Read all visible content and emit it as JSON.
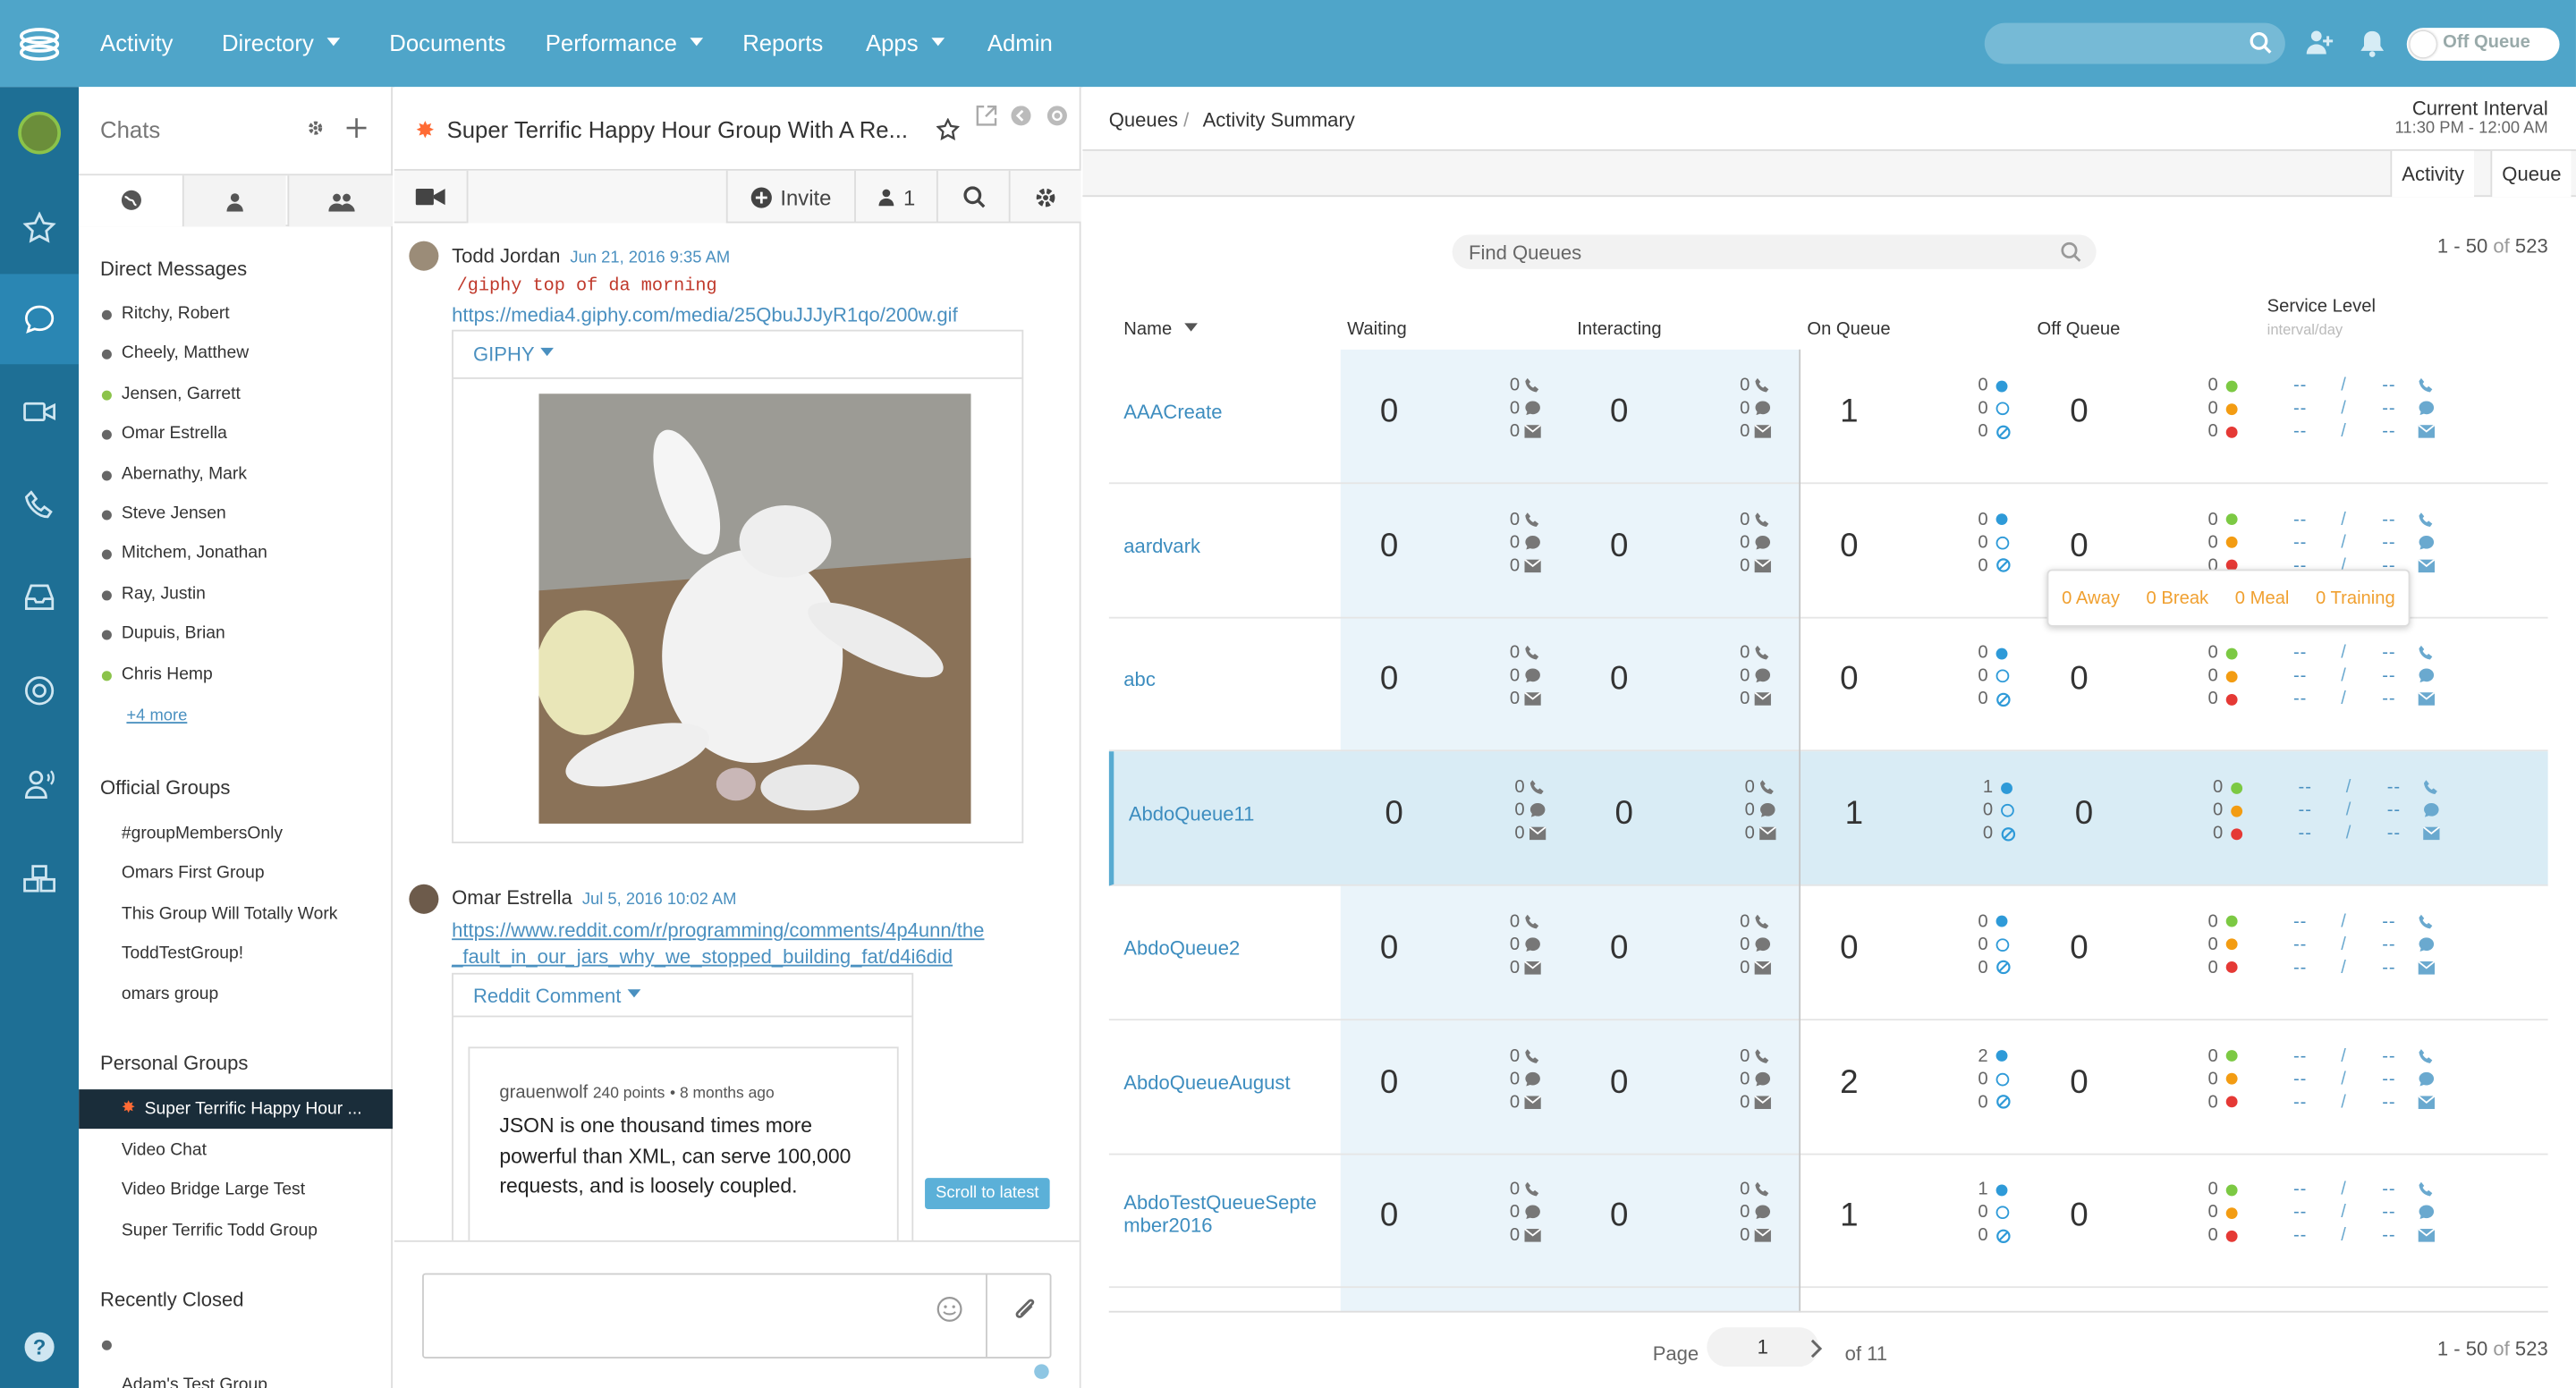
{
  "topnav": {
    "items": [
      "Activity",
      "Directory",
      "Documents",
      "Performance",
      "Reports",
      "Apps",
      "Admin"
    ],
    "status_toggle": "Off Queue"
  },
  "chats": {
    "title": "Chats",
    "direct_messages_heading": "Direct Messages",
    "direct_messages": [
      {
        "name": "Ritchy, Robert",
        "status": "offline"
      },
      {
        "name": "Cheely, Matthew",
        "status": "offline"
      },
      {
        "name": "Jensen, Garrett",
        "status": "online"
      },
      {
        "name": "Omar Estrella",
        "status": "offline"
      },
      {
        "name": "Abernathy, Mark",
        "status": "offline"
      },
      {
        "name": "Steve Jensen",
        "status": "offline"
      },
      {
        "name": "Mitchem, Jonathan",
        "status": "offline"
      },
      {
        "name": "Ray, Justin",
        "status": "offline"
      },
      {
        "name": "Dupuis, Brian",
        "status": "offline"
      },
      {
        "name": "Chris Hemp",
        "status": "online"
      }
    ],
    "more_link": "+4 more",
    "official_groups_heading": "Official Groups",
    "official_groups": [
      "#groupMembersOnly",
      "Omars First Group",
      "This Group Will Totally Work",
      "ToddTestGroup!",
      "omars group"
    ],
    "personal_groups_heading": "Personal Groups",
    "personal_groups": [
      "Super Terrific Happy Hour ...",
      "Video Chat",
      "Video Bridge Large Test",
      "Super Terrific Todd Group"
    ],
    "recently_closed_heading": "Recently Closed",
    "recently_closed": [
      "Adam's Test Group"
    ]
  },
  "conversation": {
    "title": "Super Terrific Happy Hour Group With A Re...",
    "invite_label": "Invite",
    "participants_count": "1",
    "messages": [
      {
        "author": "Todd Jordan",
        "time": "Jun 21, 2016 9:35 AM",
        "command": "/giphy top of da morning",
        "link": "https://media4.giphy.com/media/25QbuJJJyR1qo/200w.gif",
        "card_title": "GIPHY"
      },
      {
        "author": "Omar Estrella",
        "time": "Jul 5, 2016 10:02 AM",
        "link_line1": "https://www.reddit.com/r/programming/comments/4p4unn/the",
        "link_line2": "_fault_in_our_jars_why_we_stopped_building_fat/d4i6did",
        "card_title": "Reddit Comment",
        "comment_user": "grauenwolf",
        "comment_points": "240 points",
        "comment_age": "• 8 months ago",
        "comment_text": "JSON is one thousand times more powerful than XML, can serve 100,000 requests, and is loosely coupled."
      }
    ],
    "scroll_to_latest": "Scroll to latest"
  },
  "queues": {
    "breadcrumb_root": "Queues",
    "breadcrumb_sep": "/",
    "breadcrumb_page": "Activity Summary",
    "interval_title": "Current Interval",
    "interval_range": "11:30 PM - 12:00 AM",
    "view_tabs": [
      "Activity",
      "Queue"
    ],
    "search_placeholder": "Find Queues",
    "count_range": "1 - 50",
    "count_of": "of",
    "count_total": "523",
    "columns": {
      "name": "Name",
      "waiting": "Waiting",
      "interacting": "Interacting",
      "on_queue": "On Queue",
      "off_queue": "Off Queue",
      "service_level": "Service Level",
      "service_level_sub": "interval/day"
    },
    "rows": [
      {
        "name": "AAACreate",
        "waiting": "0",
        "w_call": "0",
        "w_chat": "0",
        "w_email": "0",
        "interacting": "0",
        "i_call": "0",
        "i_chat": "0",
        "i_email": "0",
        "on_queue": "1",
        "oq_available": "0",
        "oq_idle": "0",
        "oq_not_responding": "0",
        "off_queue": "0",
        "off_green": "0",
        "off_orange": "0",
        "off_red": "0"
      },
      {
        "name": "aardvark",
        "waiting": "0",
        "w_call": "0",
        "w_chat": "0",
        "w_email": "0",
        "interacting": "0",
        "i_call": "0",
        "i_chat": "0",
        "i_email": "0",
        "on_queue": "0",
        "oq_available": "0",
        "oq_idle": "0",
        "oq_not_responding": "0",
        "off_queue": "0",
        "off_green": "0",
        "off_orange": "0",
        "off_red": "0"
      },
      {
        "name": "abc",
        "waiting": "0",
        "w_call": "0",
        "w_chat": "0",
        "w_email": "0",
        "interacting": "0",
        "i_call": "0",
        "i_chat": "0",
        "i_email": "0",
        "on_queue": "0",
        "oq_available": "0",
        "oq_idle": "0",
        "oq_not_responding": "0",
        "off_queue": "0",
        "off_green": "0",
        "off_orange": "0",
        "off_red": "0"
      },
      {
        "name": "AbdoQueue11",
        "waiting": "0",
        "w_call": "0",
        "w_chat": "0",
        "w_email": "0",
        "interacting": "0",
        "i_call": "0",
        "i_chat": "0",
        "i_email": "0",
        "on_queue": "1",
        "oq_available": "1",
        "oq_idle": "0",
        "oq_not_responding": "0",
        "off_queue": "0",
        "off_green": "0",
        "off_orange": "0",
        "off_red": "0"
      },
      {
        "name": "AbdoQueue2",
        "waiting": "0",
        "w_call": "0",
        "w_chat": "0",
        "w_email": "0",
        "interacting": "0",
        "i_call": "0",
        "i_chat": "0",
        "i_email": "0",
        "on_queue": "0",
        "oq_available": "0",
        "oq_idle": "0",
        "oq_not_responding": "0",
        "off_queue": "0",
        "off_green": "0",
        "off_orange": "0",
        "off_red": "0"
      },
      {
        "name": "AbdoQueueAugust",
        "waiting": "0",
        "w_call": "0",
        "w_chat": "0",
        "w_email": "0",
        "interacting": "0",
        "i_call": "0",
        "i_chat": "0",
        "i_email": "0",
        "on_queue": "2",
        "oq_available": "2",
        "oq_idle": "0",
        "oq_not_responding": "0",
        "off_queue": "0",
        "off_green": "0",
        "off_orange": "0",
        "off_red": "0"
      },
      {
        "name": "AbdoTestQueueSeptember2016",
        "name_line1": "AbdoTestQueueSepte",
        "name_line2": "mber2016",
        "waiting": "0",
        "w_call": "0",
        "w_chat": "0",
        "w_email": "0",
        "interacting": "0",
        "i_call": "0",
        "i_chat": "0",
        "i_email": "0",
        "on_queue": "1",
        "oq_available": "1",
        "oq_idle": "0",
        "oq_not_responding": "0",
        "off_queue": "0",
        "off_green": "0",
        "off_orange": "0",
        "off_red": "0"
      }
    ],
    "sl_placeholder": "--",
    "sl_sep": "/",
    "popover": {
      "away": "0 Away",
      "break": "0 Break",
      "meal": "0 Meal",
      "training": "0 Training"
    },
    "pager": {
      "page_label": "Page",
      "page": "1",
      "of_label": "of 11"
    },
    "footer_count_range": "1 - 50",
    "footer_count_of": "of",
    "footer_count_total": "523"
  },
  "colors": {
    "nav": "#4fa5c9",
    "rail": "#1e6f95",
    "link": "#3d8dbf",
    "green": "#7cc943",
    "orange": "#f39c12",
    "red": "#e53935",
    "blue": "#2e9ad8"
  },
  "icons": [
    "app-logo-icon",
    "search-icon",
    "add-person-icon",
    "bell-icon",
    "star-icon",
    "chat-bubble-icon",
    "video-icon",
    "phone-icon",
    "inbox-icon",
    "lifebuoy-icon",
    "agent-icon",
    "cubes-icon",
    "help-icon",
    "gear-icon",
    "plus-icon",
    "globe-icon",
    "person-icon",
    "group-icon",
    "popout-icon",
    "back-icon",
    "close-icon",
    "emoji-icon",
    "paperclip-icon"
  ]
}
